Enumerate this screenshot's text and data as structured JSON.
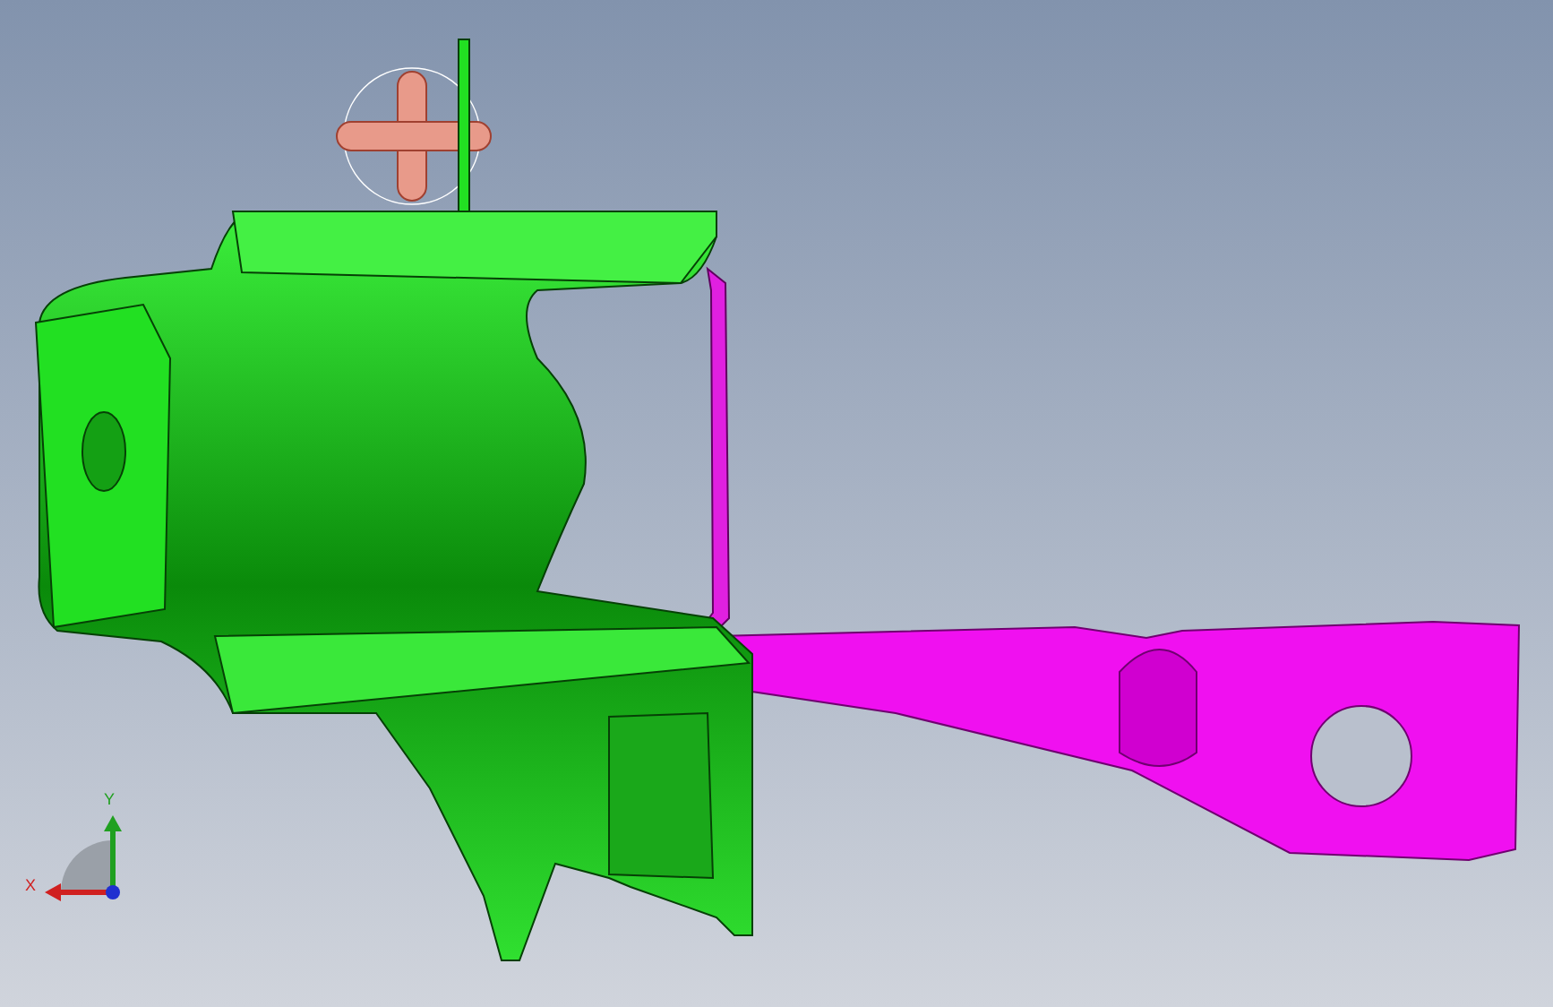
{
  "triad": {
    "y_label": "Y",
    "x_label": "X"
  }
}
